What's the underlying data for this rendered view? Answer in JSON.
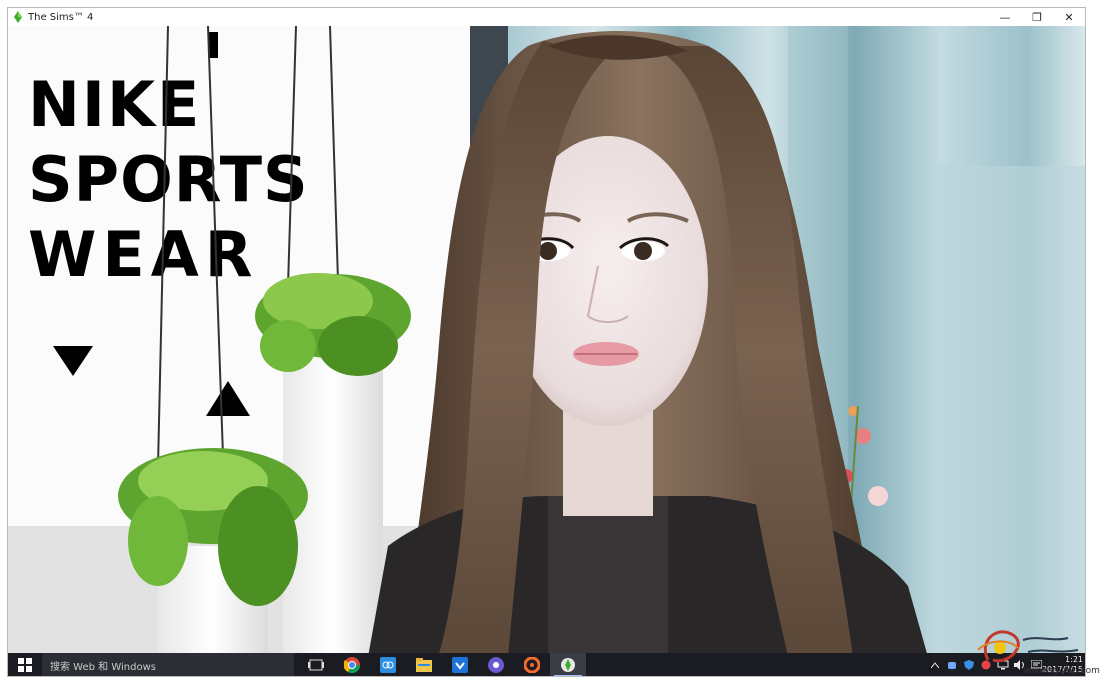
{
  "window": {
    "title": "The Sims™ 4",
    "controls": {
      "minimize": "—",
      "restore": "❐",
      "close": "✕"
    }
  },
  "scene": {
    "poster_lines": [
      "NIKE",
      "SPORTS",
      "WEAR"
    ]
  },
  "taskbar": {
    "search_placeholder": "搜索 Web 和 Windows",
    "apps": [
      {
        "name": "task-view-icon"
      },
      {
        "name": "chrome-icon"
      },
      {
        "name": "photos-icon"
      },
      {
        "name": "file-explorer-icon"
      },
      {
        "name": "shield-browser-icon"
      },
      {
        "name": "media-icon"
      },
      {
        "name": "origin-icon"
      },
      {
        "name": "sims4-icon",
        "active": true
      }
    ],
    "tray": [
      "chevron-up-icon",
      "cloud-icon",
      "shield-icon",
      "app-icon",
      "network-icon",
      "volume-icon",
      "notification-icon"
    ],
    "clock_time": "1:21",
    "clock_date": "2017/7/15"
  },
  "watermark": {
    "text": "www.sglyhp.com"
  },
  "colors": {
    "taskbar": "#1a1c22",
    "accent": "#9ec3ff"
  }
}
